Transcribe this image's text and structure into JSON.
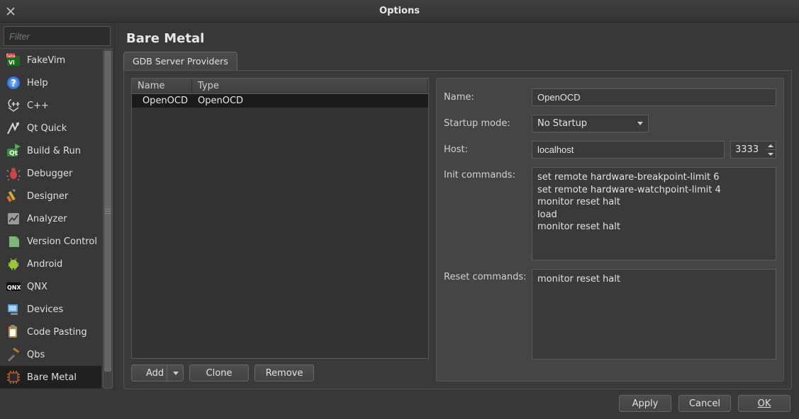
{
  "window": {
    "title": "Options"
  },
  "sidebar": {
    "filter_placeholder": "Filter",
    "items": [
      {
        "label": "FakeVim"
      },
      {
        "label": "Help"
      },
      {
        "label": "C++"
      },
      {
        "label": "Qt Quick"
      },
      {
        "label": "Build & Run"
      },
      {
        "label": "Debugger"
      },
      {
        "label": "Designer"
      },
      {
        "label": "Analyzer"
      },
      {
        "label": "Version Control"
      },
      {
        "label": "Android"
      },
      {
        "label": "QNX"
      },
      {
        "label": "Devices"
      },
      {
        "label": "Code Pasting"
      },
      {
        "label": "Qbs"
      },
      {
        "label": "Bare Metal"
      }
    ]
  },
  "page": {
    "title": "Bare Metal",
    "tab": "GDB Server Providers",
    "table": {
      "col_name": "Name",
      "col_type": "Type",
      "rows": [
        {
          "name": "OpenOCD",
          "type": "OpenOCD"
        }
      ]
    },
    "buttons": {
      "add": "Add",
      "clone": "Clone",
      "remove": "Remove"
    },
    "form": {
      "name_label": "Name:",
      "name_value": "OpenOCD",
      "startup_label": "Startup mode:",
      "startup_value": "No Startup",
      "host_label": "Host:",
      "host_value": "localhost",
      "port_value": "3333",
      "init_label": "Init commands:",
      "init_value": "set remote hardware-breakpoint-limit 6\nset remote hardware-watchpoint-limit 4\nmonitor reset halt\nload\nmonitor reset halt",
      "reset_label": "Reset commands:",
      "reset_value": "monitor reset halt"
    }
  },
  "footer": {
    "apply": "Apply",
    "cancel": "Cancel",
    "ok": "OK"
  }
}
